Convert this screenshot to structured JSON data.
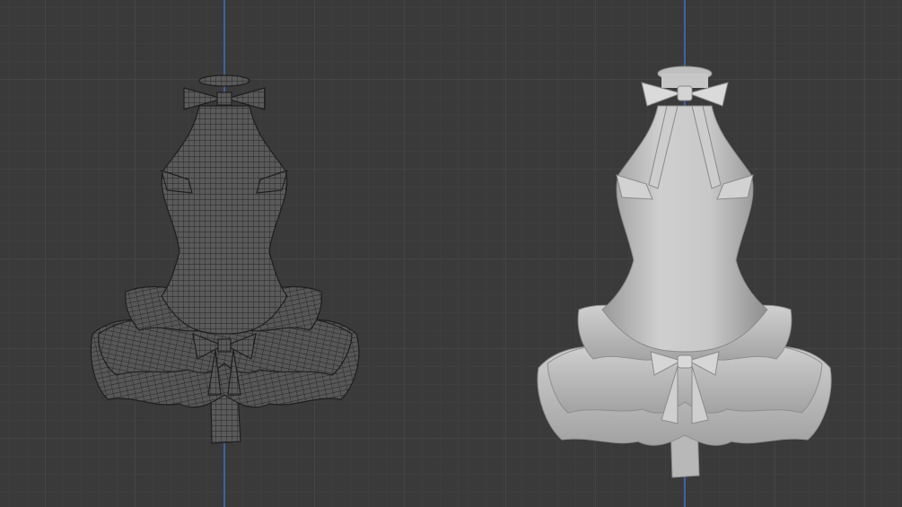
{
  "scene": {
    "background_color": "#3a3a3a",
    "grid_minor_color": "#434343",
    "grid_major_color": "#4a4a4a",
    "axis_color": "#3d6fb8"
  },
  "viewports": [
    {
      "id": "left",
      "shading": "wireframe",
      "object": "dress",
      "object_color": "#5a5a5a",
      "wire_color": "#1e1e1e"
    },
    {
      "id": "right",
      "shading": "solid",
      "object": "dress",
      "object_color": "#c4c4c4",
      "shadow_color": "#8e8e8e"
    }
  ]
}
